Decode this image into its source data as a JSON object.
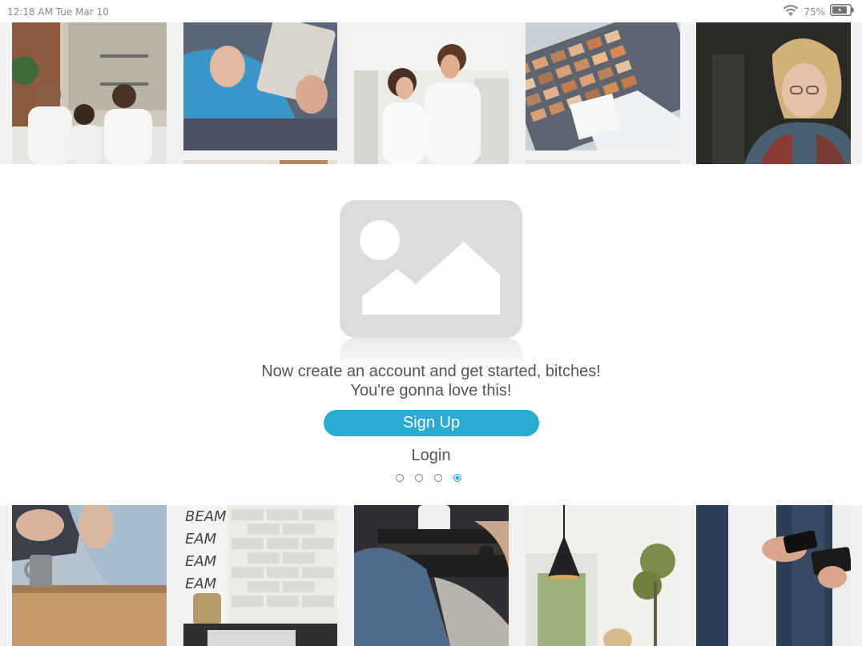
{
  "status_bar": {
    "time": "12:18 AM  Tue Mar 10",
    "battery_percent": "75%",
    "battery_level": 0.75,
    "icons": [
      "wifi-icon",
      "battery-icon"
    ]
  },
  "gallery": {
    "top_row": [
      "family-on-couch-photo",
      "hands-holding-tablet-photo",
      "couple-in-kitchen-photo",
      "material-swatches-photo",
      "woman-with-glasses-photo"
    ],
    "bottom_row": [
      "coffee-mug-on-table-photo",
      "brick-wall-kitchen-photo",
      "person-with-mug-photo",
      "pendant-lamp-room-photo",
      "man-with-phone-photo"
    ]
  },
  "onboarding": {
    "image_placeholder_icon": "image-placeholder-icon",
    "message_line1": "Now create an account and get started, bitches!",
    "message_line2": "You're gonna love this!",
    "signup_label": "Sign Up",
    "login_label": "Login",
    "page_indicator": {
      "total": 4,
      "current": 4
    }
  },
  "colors": {
    "accent": "#2aabcf",
    "text": "#555555",
    "placeholder": "#dcdcdc"
  }
}
